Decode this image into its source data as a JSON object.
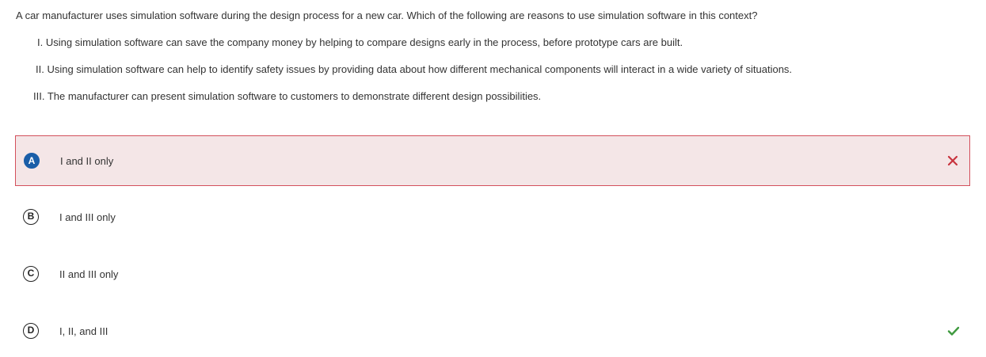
{
  "question": {
    "stem": "A car manufacturer uses simulation software during the design process for a new car. Which of the following are reasons to use simulation software in this context?",
    "statements": [
      "I. Using simulation software can save the company money by helping to compare designs early in the process, before prototype cars are built.",
      "II. Using simulation software can help to identify safety issues by providing data about how different mechanical components will interact in a wide variety of situations.",
      "III. The manufacturer can present simulation software to customers to demonstrate different design possibilities."
    ]
  },
  "choices": [
    {
      "letter": "A",
      "text": "I and II only",
      "selected": true,
      "result": "incorrect",
      "result_icon": "x-mark-icon"
    },
    {
      "letter": "B",
      "text": "I and III only",
      "selected": false,
      "result": "none"
    },
    {
      "letter": "C",
      "text": "II and III only",
      "selected": false,
      "result": "none"
    },
    {
      "letter": "D",
      "text": "I, II, and III",
      "selected": false,
      "result": "correct",
      "result_icon": "check-mark-icon"
    }
  ],
  "colors": {
    "selected_badge": "#1a5ea8",
    "incorrect_bg": "#f4e6e7",
    "incorrect_border": "#d3505c",
    "incorrect_mark": "#c8343f",
    "correct_mark": "#3f9a3f"
  }
}
